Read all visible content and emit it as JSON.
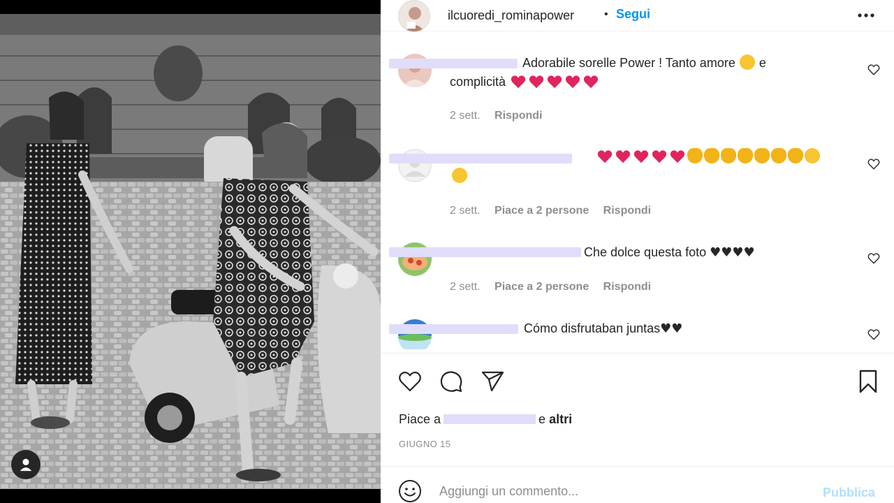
{
  "post": {
    "username": "ilcuoredi_rominapower",
    "separator": "•",
    "follow_label": "Segui"
  },
  "comments": [
    {
      "text": "Adorabile sorelle Power ! Tanto amore",
      "text_after_emoji": "e",
      "line2": "complicità",
      "time": "2 sett.",
      "reply": "Rispondi"
    },
    {
      "time": "2 sett.",
      "likes": "Piace a 2 persone",
      "reply": "Rispondi"
    },
    {
      "text": "Che dolce questa foto",
      "time": "2 sett.",
      "likes": "Piace a 2 persone",
      "reply": "Rispondi"
    },
    {
      "text": "Cómo disfrutaban juntas"
    }
  ],
  "likes_line": {
    "prefix": "Piace a",
    "suffix": "e",
    "others": "altri"
  },
  "date": "GIUGNO 15",
  "composer": {
    "placeholder": "Aggiungi un commento...",
    "post_label": "Pubblica"
  },
  "icons": {
    "more": "more-options-icon",
    "like": "heart-icon",
    "comment": "comment-icon",
    "share": "share-icon",
    "save": "bookmark-icon",
    "emoji": "smiley-icon",
    "tag": "user-tag-icon"
  },
  "colors": {
    "accent": "#0095f6",
    "post_disabled": "#b2dffc",
    "redaction": "#e0ddfa",
    "muted": "#8e8e8e"
  }
}
